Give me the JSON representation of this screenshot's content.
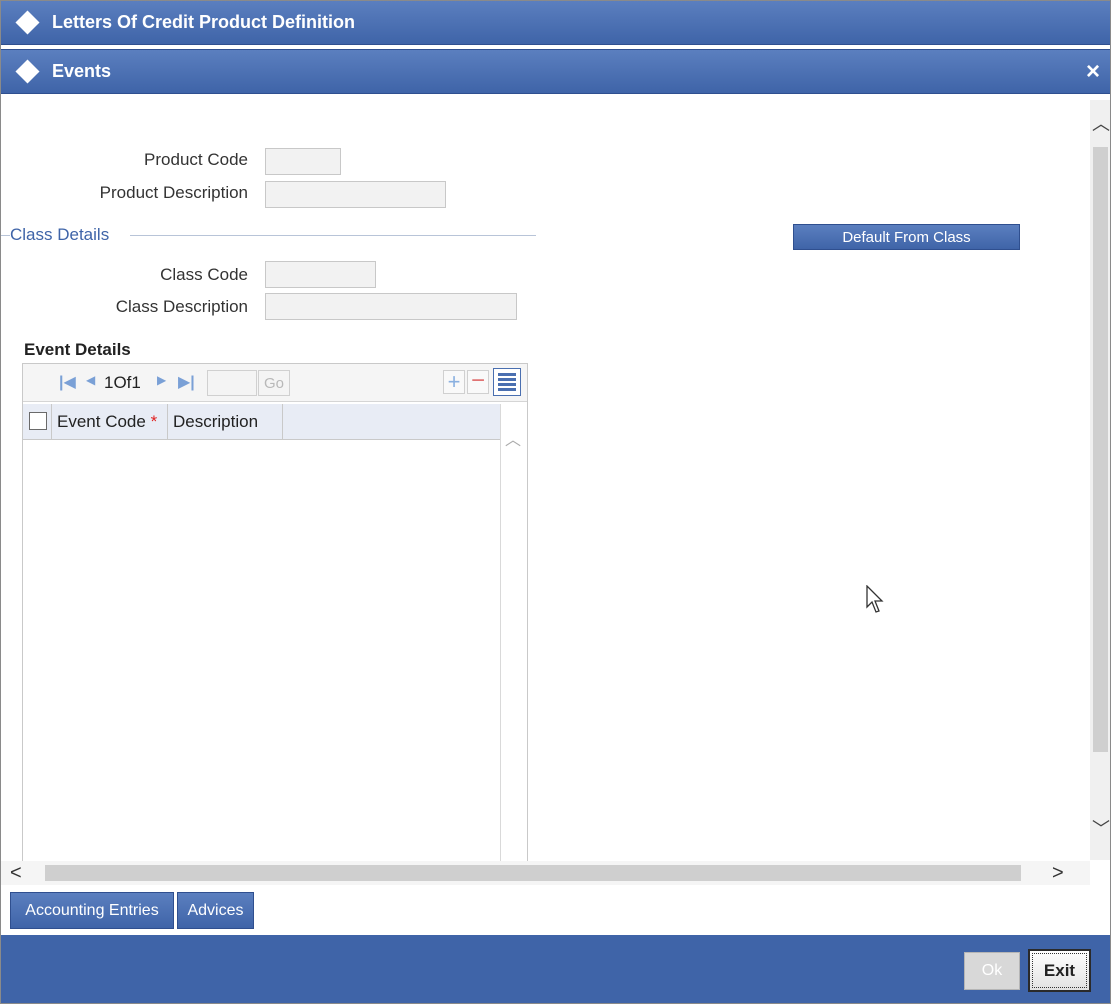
{
  "window": {
    "title": "Letters Of Credit Product Definition",
    "subtitle": "Events",
    "close_icon": "×"
  },
  "product": {
    "code_label": "Product Code",
    "code_value": "",
    "description_label": "Product Description",
    "description_value": ""
  },
  "class_details": {
    "title": "Class Details",
    "code_label": "Class Code",
    "code_value": "",
    "description_label": "Class Description",
    "description_value": "",
    "default_button": "Default From Class"
  },
  "event_details": {
    "title": "Event Details",
    "pager": {
      "first_icon": "first-page-icon",
      "prev_icon": "prev-page-icon",
      "page_text": "1Of1",
      "next_icon": "next-page-icon",
      "last_icon": "last-page-icon",
      "page_input": "",
      "go_label": "Go"
    },
    "columns": [
      "Event Code",
      "Description"
    ],
    "required_marker": "*",
    "rows": []
  },
  "tabs": [
    "Accounting Entries",
    "Advices"
  ],
  "footer": {
    "ok_label": "Ok",
    "exit_label": "Exit"
  },
  "colors": {
    "title_bar": "#3f64a8",
    "accent_text": "#3f64a8",
    "required": "#e02020"
  }
}
